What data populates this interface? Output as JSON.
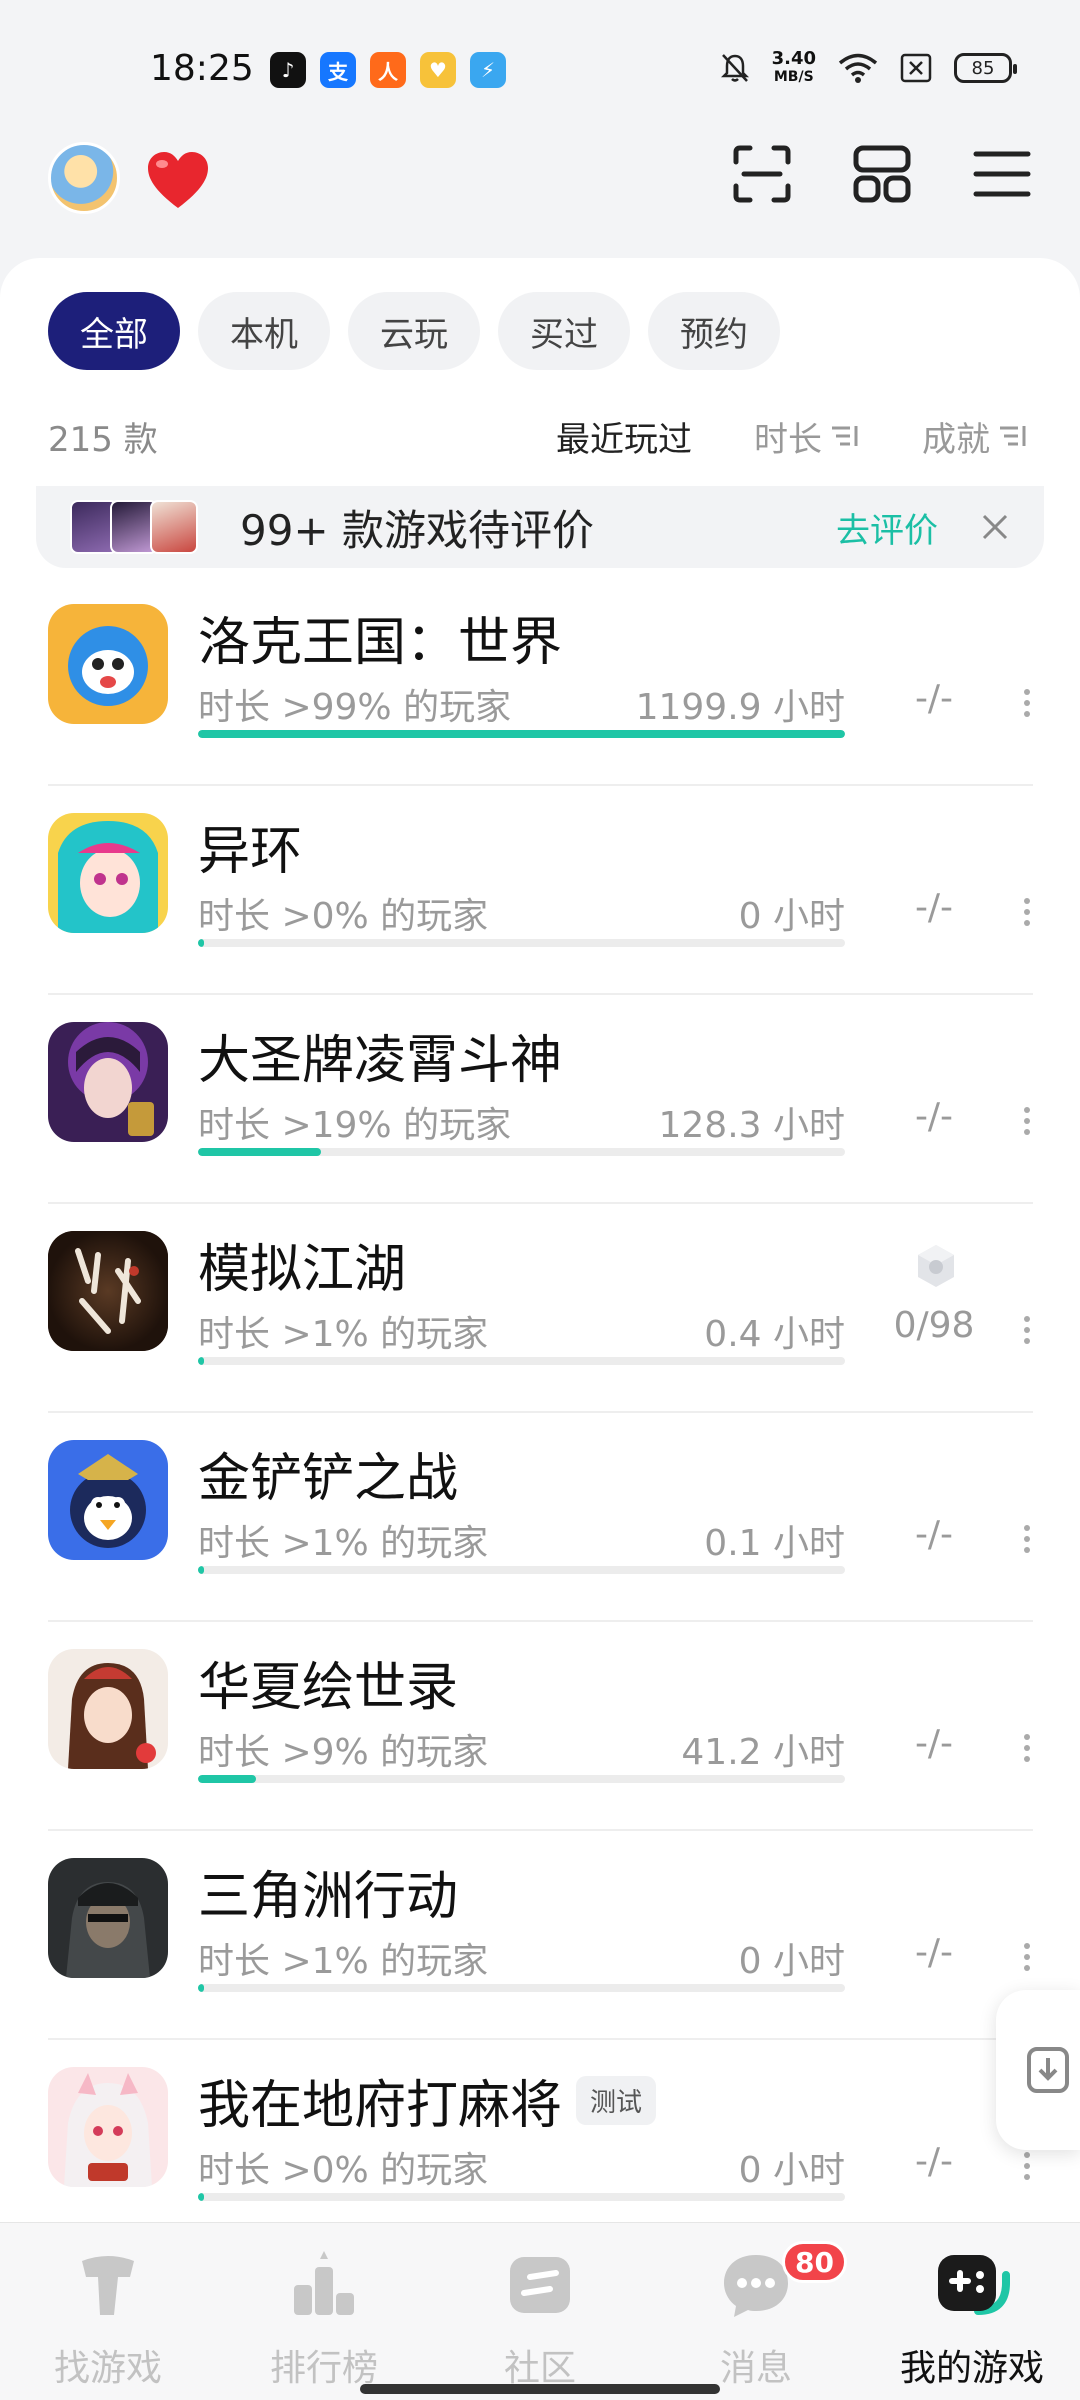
{
  "status_bar": {
    "time": "18:25",
    "net_speed_value": "3.40",
    "net_speed_unit": "MB/S",
    "battery": "85",
    "apps": [
      {
        "name": "tiktok-app-icon",
        "glyph": "♪",
        "color": "#111111"
      },
      {
        "name": "alipay-app-icon",
        "glyph": "支",
        "color": "#1677ff"
      },
      {
        "name": "delivery-app-icon",
        "glyph": "人",
        "color": "#ff6a1a"
      },
      {
        "name": "yellow-app-icon",
        "glyph": "♥",
        "color": "#f7c23a"
      },
      {
        "name": "shield-app-icon",
        "glyph": "⚡",
        "color": "#3aa7f0"
      }
    ]
  },
  "header": {
    "icons": [
      "avatar",
      "heart-icon",
      "scan-icon",
      "grid-icon",
      "menu-icon"
    ]
  },
  "filters": [
    "全部",
    "本机",
    "云玩",
    "买过",
    "预约"
  ],
  "sort_bar": {
    "count": "215 款",
    "recent": "最近玩过",
    "duration": "时长",
    "achievement": "成就"
  },
  "banner": {
    "text": "99+ 款游戏待评价",
    "link": "去评价"
  },
  "games": [
    {
      "name": "洛克王国：世界",
      "percent_text": "时长 >99% 的玩家",
      "hours": "1199.9 小时",
      "achievement": "-/-",
      "progress": 1.0,
      "tag": ""
    },
    {
      "name": "异环",
      "percent_text": "时长 >0% 的玩家",
      "hours": "0 小时",
      "achievement": "-/-",
      "progress": 0.01,
      "tag": ""
    },
    {
      "name": "大圣牌凌霄斗神",
      "percent_text": "时长 >19% 的玩家",
      "hours": "128.3 小时",
      "achievement": "-/-",
      "progress": 0.19,
      "tag": ""
    },
    {
      "name": "模拟江湖",
      "percent_text": "时长 >1% 的玩家",
      "hours": "0.4 小时",
      "achievement": "0/98",
      "progress": 0.01,
      "tag": ""
    },
    {
      "name": "金铲铲之战",
      "percent_text": "时长 >1% 的玩家",
      "hours": "0.1 小时",
      "achievement": "-/-",
      "progress": 0.01,
      "tag": ""
    },
    {
      "name": "华夏绘世录",
      "percent_text": "时长 >9% 的玩家",
      "hours": "41.2 小时",
      "achievement": "-/-",
      "progress": 0.09,
      "tag": ""
    },
    {
      "name": "三角洲行动",
      "percent_text": "时长 >1% 的玩家",
      "hours": "0 小时",
      "achievement": "-/-",
      "progress": 0.01,
      "tag": ""
    },
    {
      "name": "我在地府打麻将",
      "percent_text": "时长 >0% 的玩家",
      "hours": "0 小时",
      "achievement": "-/-",
      "progress": 0.01,
      "tag": "测试"
    }
  ],
  "bottom_nav": [
    {
      "label": "找游戏",
      "icon": "find-games-icon",
      "active": false
    },
    {
      "label": "排行榜",
      "icon": "leaderboard-icon",
      "active": false
    },
    {
      "label": "社区",
      "icon": "community-icon",
      "active": false
    },
    {
      "label": "消息",
      "icon": "messages-icon",
      "active": false,
      "badge": "80"
    },
    {
      "label": "我的游戏",
      "icon": "my-games-icon",
      "active": true
    }
  ],
  "colors": {
    "accent": "#1fc6a6",
    "active_chip": "#1d1f7a",
    "badge": "#f2444a"
  }
}
